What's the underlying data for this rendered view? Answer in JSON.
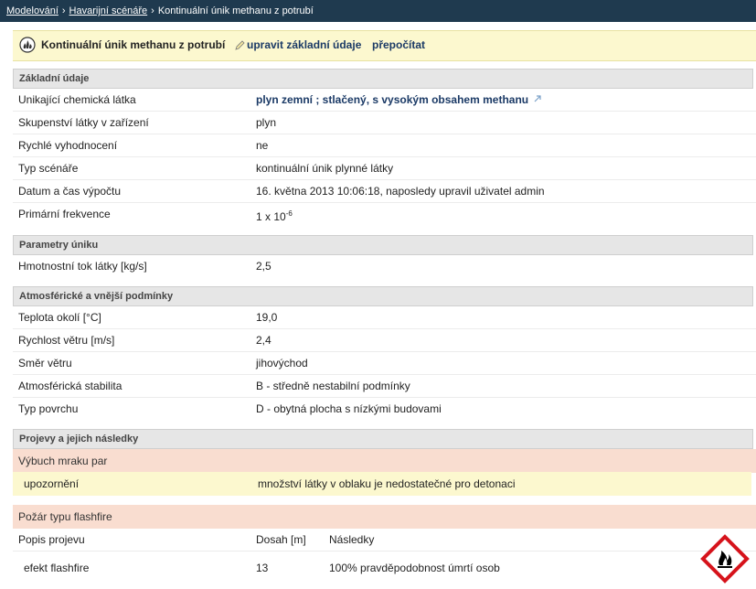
{
  "breadcrumb": {
    "items": [
      "Modelování",
      "Havarijní scénáře"
    ],
    "current": "Kontinuální únik methanu z potrubí",
    "separator": "›"
  },
  "header": {
    "title": "Kontinuální únik methanu z potrubí",
    "edit_label": "upravit základní údaje",
    "recalc_label": "přepočítat"
  },
  "sections": {
    "basic": {
      "title": "Základní údaje",
      "rows": [
        {
          "label": "Unikající chemická látka",
          "value": "plyn zemní ; stlačený, s vysokým obsahem methanu"
        },
        {
          "label": "Skupenství látky v zařízení",
          "value": "plyn"
        },
        {
          "label": "Rychlé vyhodnocení",
          "value": "ne"
        },
        {
          "label": "Typ scénáře",
          "value": "kontinuální únik plynné látky"
        },
        {
          "label": "Datum a čas výpočtu",
          "value": "16. května 2013 10:06:18, naposledy upravil uživatel admin"
        },
        {
          "label": "Primární frekvence",
          "value_base": "1 x 10",
          "value_exp": "-6"
        }
      ]
    },
    "release": {
      "title": "Parametry úniku",
      "rows": [
        {
          "label": "Hmotnostní tok látky [kg/s]",
          "value": "2,5"
        }
      ]
    },
    "atmosphere": {
      "title": "Atmosférické a vnější podmínky",
      "rows": [
        {
          "label": "Teplota okolí [°C]",
          "value": "19,0"
        },
        {
          "label": "Rychlost větru [m/s]",
          "value": "2,4"
        },
        {
          "label": "Směr větru",
          "value": "jihovýchod"
        },
        {
          "label": "Atmosférická stabilita",
          "value": "B - středně nestabilní podmínky"
        },
        {
          "label": "Typ povrchu",
          "value": "D - obytná plocha s nízkými budovami"
        }
      ]
    },
    "effects": {
      "title": "Projevy a jejich následky",
      "explosion": {
        "title": "Výbuch mraku par",
        "warning_label": "upozornění",
        "warning_text": "množství látky v oblaku je nedostatečné pro detonaci"
      },
      "flashfire": {
        "title": "Požár typu flashfire",
        "columns": [
          "Popis projevu",
          "Dosah [m]",
          "Následky"
        ],
        "rows": [
          {
            "name": "efekt flashfire",
            "range": "13",
            "consequence": "100% pravděpodobnost úmrtí osob"
          }
        ]
      }
    }
  },
  "icons": {
    "scenario": "flame-scenario-icon",
    "edit": "pencil-icon",
    "external_link": "external-link-icon",
    "hazard": "flammable-hazard-pictogram"
  },
  "colors": {
    "topbar": "#1f3a4f",
    "title_bg": "#fcf8cf",
    "section_bg": "#e6e6e6",
    "subhead_bg": "#f9ddd0",
    "link": "#1b3a66",
    "hazard_red": "#d6131b"
  }
}
